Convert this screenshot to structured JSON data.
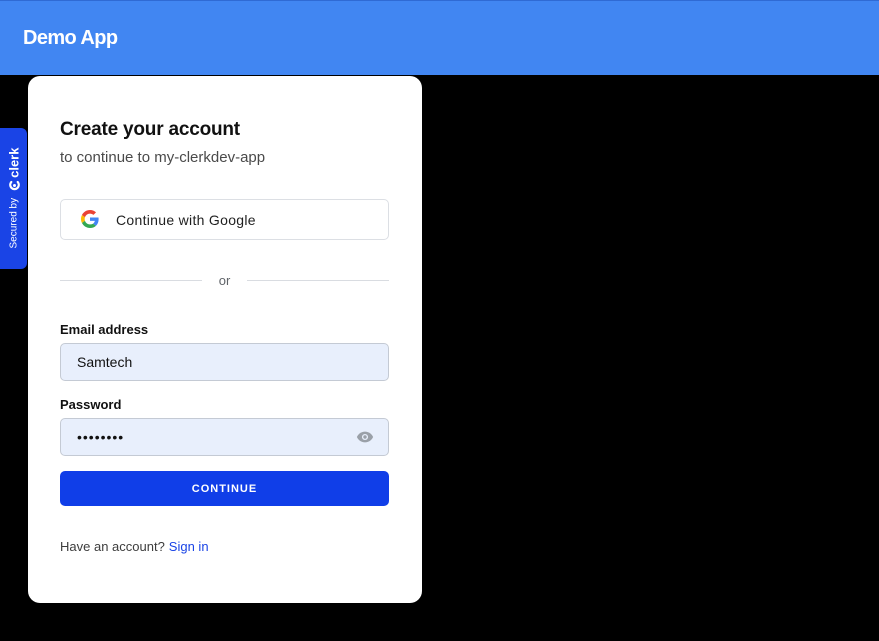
{
  "header": {
    "app_title": "Demo App"
  },
  "badge": {
    "secured_label": "Secured by",
    "brand": "clerk"
  },
  "signup": {
    "title": "Create your account",
    "subtitle": "to continue to my-clerkdev-app",
    "google_button": "Continue with Google",
    "divider": "or",
    "email_label": "Email address",
    "email_value": "Samtech",
    "password_label": "Password",
    "password_value": "••••••••",
    "continue_button": "CONTINUE",
    "footer_text": "Have an account?",
    "signin_link": "Sign in"
  },
  "colors": {
    "header_bg": "#4186f2",
    "page_bg": "#000000",
    "primary": "#103ee8",
    "field_bg": "#e8effc",
    "badge_bg": "#1a44e6"
  }
}
